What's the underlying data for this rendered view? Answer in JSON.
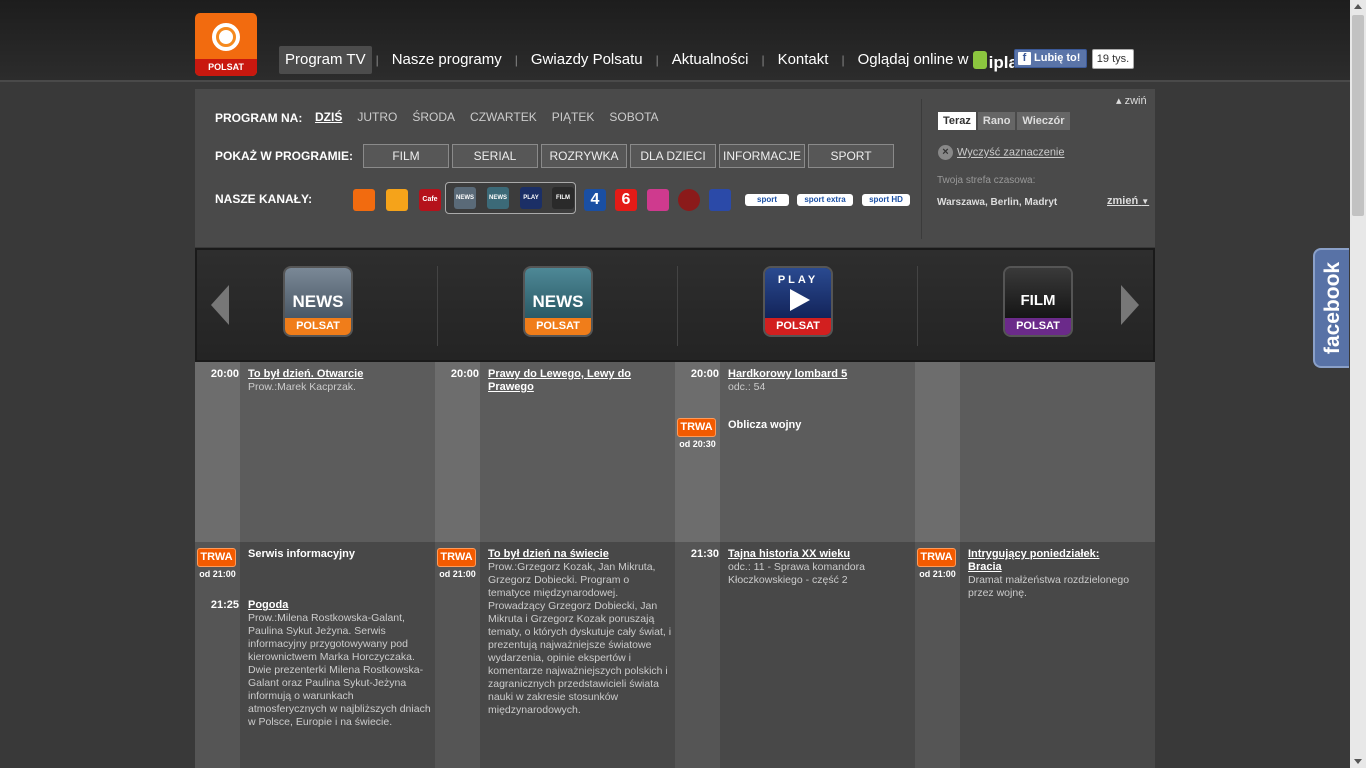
{
  "header": {
    "logo_text": "POLSAT",
    "nav": [
      "Program TV",
      "Nasze programy",
      "Gwiazdy Polsatu",
      "Aktualności",
      "Kontakt",
      "Oglądaj online w"
    ],
    "ipla": "ipla",
    "like_label": "Lubię to!",
    "like_count": "19 tys."
  },
  "filters": {
    "program_label": "PROGRAM NA:",
    "days": [
      "DZIŚ",
      "JUTRO",
      "ŚRODA",
      "CZWARTEK",
      "PIĄTEK",
      "SOBOTA"
    ],
    "show_label": "POKAŻ W PROGRAMIE:",
    "genres": [
      "FILM",
      "SERIAL",
      "ROZRYWKA",
      "DLA DZIECI",
      "INFORMACJE",
      "SPORT"
    ],
    "channels_label": "NASZE KANAŁY:",
    "channels": [
      "POLSAT",
      "POLSAT 2",
      "Cafe",
      "NEWS",
      "NEWS 2",
      "PLAY",
      "FILM",
      "4",
      "6",
      "Polsat BeOne",
      "Polsat Viasat",
      "DISCO POLO MUSIC",
      "sport",
      "sport extra",
      "sport HD"
    ],
    "collapse": "zwiń",
    "time_tabs": [
      "Teraz",
      "Rano",
      "Wieczór"
    ],
    "clear": "Wyczyść zaznaczenie",
    "tz_label": "Twoja strefa czasowa:",
    "tz_value": "Warszawa, Berlin, Madryt",
    "tz_change": "zmień"
  },
  "carousel": [
    {
      "name": "NEWS",
      "sub": "POLSAT"
    },
    {
      "name": "NEWS",
      "sub": "POLSAT"
    },
    {
      "name": "PLAY",
      "sub": "POLSAT"
    },
    {
      "name": "FILM",
      "sub": "POLSAT"
    }
  ],
  "schedule": {
    "now_label": "TRWA",
    "col1": {
      "a_time": "20:00",
      "a_title": "To był dzień. Otwarcie",
      "a_desc": "Prow.:Marek Kacprzak.",
      "b_since": "od 21:00",
      "b_title": "Serwis informacyjny",
      "c_time": "21:25",
      "c_title": "Pogoda",
      "c_desc": "Prow.:Milena Rostkowska-Galant, Paulina Sykut Jeżyna. Serwis informacyjny przygotowywany pod kierownictwem Marka Horczyczaka. Dwie prezenterki Milena Rostkowska-Galant oraz Paulina Sykut-Jeżyna informują o warunkach atmosferycznych w najbliższych dniach w Polsce, Europie i na świecie."
    },
    "col2": {
      "a_time": "20:00",
      "a_title": "Prawy do Lewego, Lewy do Prawego",
      "b_since": "od 21:00",
      "b_title": "To był dzień na świecie",
      "b_desc": "Prow.:Grzegorz Kozak, Jan Mikruta, Grzegorz Dobiecki. Program o tematyce międzynarodowej. Prowadzący Grzegorz Dobiecki, Jan Mikruta i Grzegorz Kozak poruszają tematy, o których dyskutuje cały świat, i prezentują najważniejsze światowe wydarzenia, opinie ekspertów i komentarze najważniejszych polskich i zagranicznych przedstawicieli świata nauki w zakresie stosunków międzynarodowych."
    },
    "col3": {
      "a_time": "20:00",
      "a_title": "Hardkorowy lombard 5",
      "a_desc": "odc.: 54",
      "b_since": "od 20:30",
      "b_title": "Oblicza wojny",
      "c_time": "21:30",
      "c_title": "Tajna historia XX wieku",
      "c_desc": "odc.: 11 - Sprawa komandora Kłoczkowskiego - część 2"
    },
    "col4": {
      "b_since": "od 21:00",
      "b_title": "Intrygujący poniedziałek: Bracia",
      "b_desc": "Dramat małżeństwa rozdzielonego przez wojnę."
    }
  },
  "side_tab": "facebook",
  "colors": {
    "brand": "#f26b0f",
    "now": "#f25a00",
    "facebook": "#3b5998"
  }
}
